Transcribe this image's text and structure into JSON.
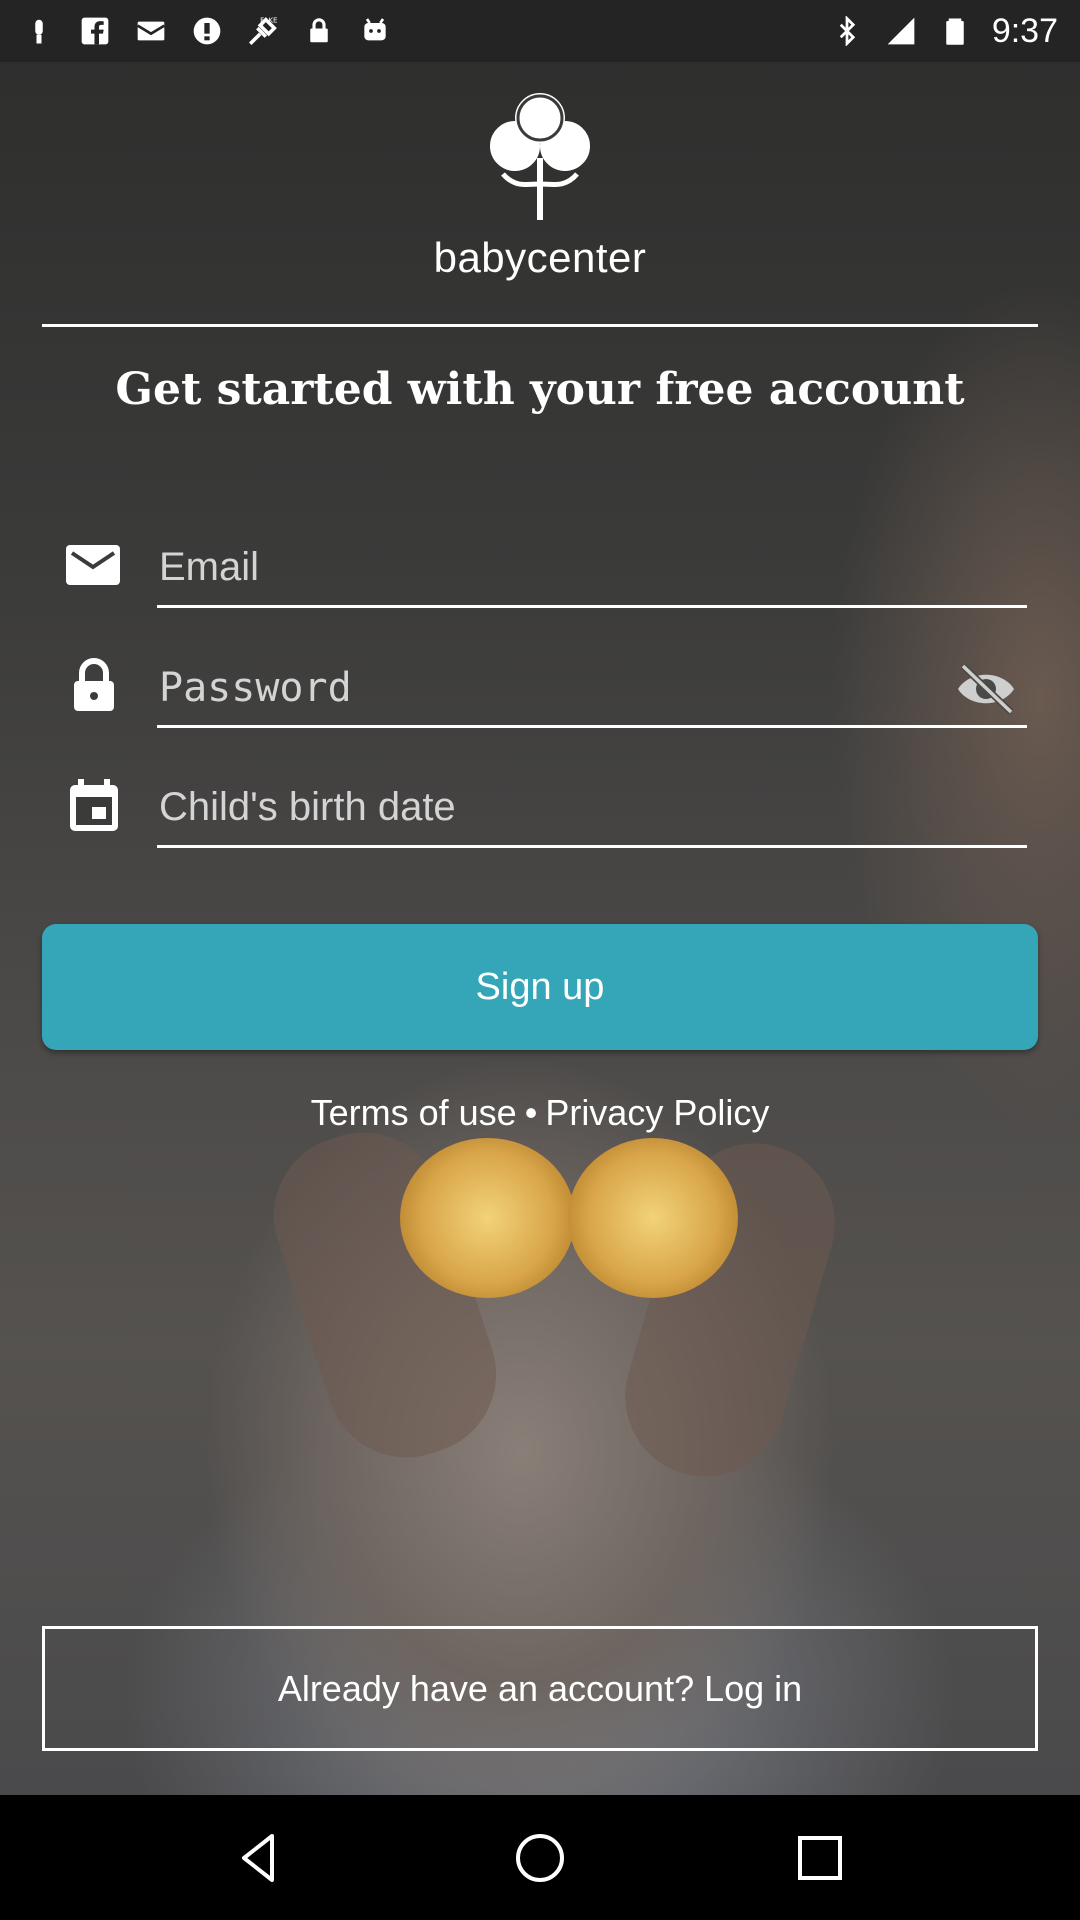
{
  "status_bar": {
    "time": "9:37",
    "left_icons": [
      "notification-icon",
      "fb-icon",
      "mail-icon",
      "info-icon",
      "fake-gps-icon",
      "lock-icon",
      "android-icon"
    ],
    "right_icons": [
      "bluetooth-icon",
      "signal-icon",
      "battery-icon"
    ]
  },
  "brand": {
    "name": "babycenter",
    "trademark": "™"
  },
  "headline": "Get started with your free account",
  "form": {
    "email_placeholder": "Email",
    "password_placeholder": "Password",
    "birthdate_placeholder": "Child's birth date",
    "email_icon": "mail-icon",
    "password_icon": "lock-icon",
    "birthdate_icon": "calendar-icon",
    "toggle_icon": "eye-off-icon"
  },
  "actions": {
    "signup_label": "Sign up",
    "terms_label": "Terms of use",
    "separator": "•",
    "privacy_label": "Privacy Policy",
    "login_label": "Already have an account? Log in"
  },
  "colors": {
    "primary": "#35a6b8",
    "status_bar": "#242424",
    "text": "#ffffff"
  },
  "nav": {
    "icons": [
      "back-icon",
      "home-icon",
      "recents-icon"
    ]
  }
}
